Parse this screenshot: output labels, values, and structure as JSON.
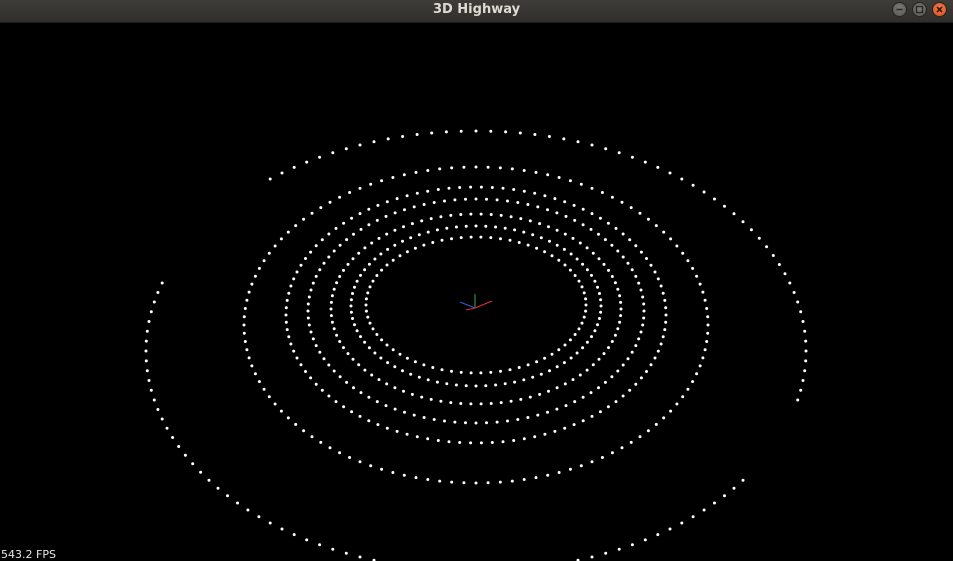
{
  "window": {
    "title": "3D Highway",
    "controls": [
      "minimize-icon",
      "maximize-icon",
      "close-icon"
    ]
  },
  "viewport": {
    "fps_label": "543.2 FPS",
    "background": "#000000",
    "point_color": "#ffffff",
    "axis_colors": {
      "x": "#e0303a",
      "y": "#2f8f3a",
      "z": "#3a56d0"
    }
  },
  "colors": {
    "titlebar": "#3b3a37",
    "close": "#e05a27"
  }
}
